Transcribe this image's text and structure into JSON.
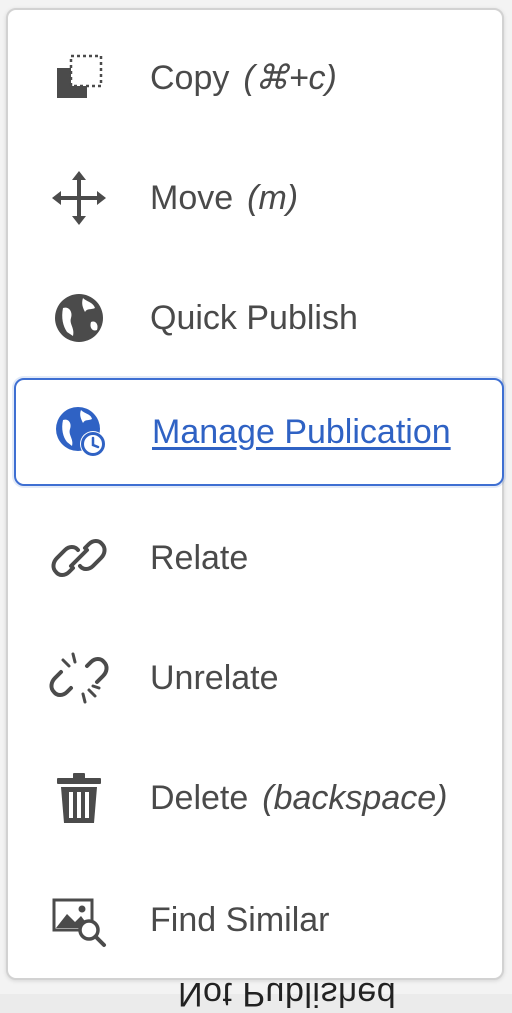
{
  "background": {
    "peek_text": "Not Published"
  },
  "menu": {
    "items": [
      {
        "label": "Copy",
        "shortcut": "(⌘+c)",
        "icon": "copy-icon"
      },
      {
        "label": "Move",
        "shortcut": "(m)",
        "icon": "move-icon"
      },
      {
        "label": "Quick Publish",
        "shortcut": "",
        "icon": "globe-icon"
      },
      {
        "label": "Manage Publication",
        "shortcut": "",
        "icon": "globe-clock-icon",
        "focused": true
      },
      {
        "label": "Relate",
        "shortcut": "",
        "icon": "link-icon"
      },
      {
        "label": "Unrelate",
        "shortcut": "",
        "icon": "unlink-icon"
      },
      {
        "label": "Delete",
        "shortcut": "(backspace)",
        "icon": "trash-icon"
      },
      {
        "label": "Find Similar",
        "shortcut": "",
        "icon": "image-search-icon"
      }
    ]
  },
  "colors": {
    "text": "#4a4a4a",
    "icon": "#4b4b4b",
    "focus_accent": "#2f62c4",
    "focus_border": "#3e6fd2"
  }
}
